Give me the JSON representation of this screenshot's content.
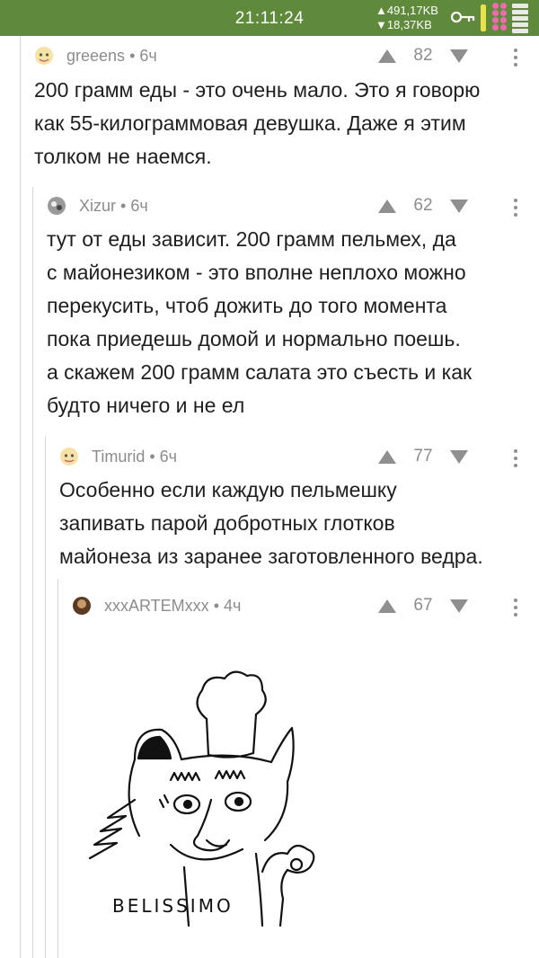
{
  "status_bar": {
    "time": "21:11:24",
    "upload": "▲491,17KB",
    "download": "▼18,37KB"
  },
  "comments": [
    {
      "username": "greeens",
      "meta": "• 6ч",
      "score": "82",
      "text": "200 грамм еды - это очень мало. Это я говорю\nкак 55-килограммовая девушка. Даже я этим\nтолком не наемся."
    },
    {
      "username": "Xizur",
      "meta": "• 6ч",
      "score": "62",
      "text": "тут от еды зависит. 200 грамм пельмех, да\nс майонезиком - это вполне неплохо можно\nперекусить, чтоб дожить до того момента\nпока приедешь домой и нормально поешь.\nа скажем 200 грамм салата это съесть и как\nбудто ничего и не ел"
    },
    {
      "username": "Timurid",
      "meta": "• 6ч",
      "score": "77",
      "text": "Особенно если каждую пельмешку\nзапивать парой добротных глотков\nмайонеза из заранее заготовленного ведра."
    },
    {
      "username": "xxxARTEMxxx",
      "meta": "• 4ч",
      "score": "67",
      "image_caption": "BELISSIMO"
    }
  ],
  "colors": {
    "status_bar": "#5f8a3b",
    "meta_text": "#8c8c8c",
    "thread_line": "#d6d6d6"
  }
}
